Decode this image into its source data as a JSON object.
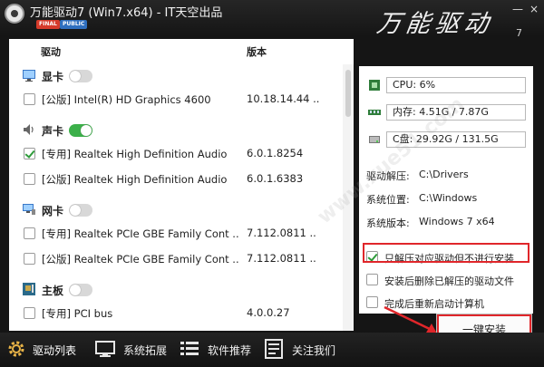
{
  "window": {
    "title": "万能驱动7 (Win7.x64) - IT天空出品",
    "badge_final": "FINAL",
    "badge_public": "PUBLIC",
    "brand": "万能驱动",
    "brand_version": "7",
    "minimize": "—",
    "close": "×"
  },
  "list": {
    "col_driver": "驱动",
    "col_version": "版本",
    "categories": [
      {
        "label": "显卡",
        "toggle_on": false,
        "icon": "display-card-icon",
        "drivers": [
          {
            "name": "[公版] Intel(R) HD Graphics 4600",
            "version": "10.18.14.44 ..",
            "checked": false
          }
        ]
      },
      {
        "label": "声卡",
        "toggle_on": true,
        "icon": "speaker-icon",
        "drivers": [
          {
            "name": "[专用] Realtek High Definition Audio",
            "version": "6.0.1.8254",
            "checked": true
          },
          {
            "name": "[公版] Realtek High Definition Audio",
            "version": "6.0.1.6383",
            "checked": false
          }
        ]
      },
      {
        "label": "网卡",
        "toggle_on": false,
        "icon": "network-icon",
        "drivers": [
          {
            "name": "[专用] Realtek PCIe GBE Family Cont ..",
            "version": "7.112.0811 ..",
            "checked": false
          },
          {
            "name": "[公版] Realtek PCIe GBE Family Cont ..",
            "version": "7.112.0811 ..",
            "checked": false
          }
        ]
      },
      {
        "label": "主板",
        "toggle_on": false,
        "icon": "motherboard-icon",
        "drivers": [
          {
            "name": "[专用] PCI bus",
            "version": "4.0.0.27",
            "checked": false
          }
        ]
      }
    ]
  },
  "system": {
    "cpu": "CPU:  6%",
    "memory": "内存:  4.51G / 7.87G",
    "disk": "C盘:  29.92G / 131.5G",
    "info": [
      {
        "label": "驱动解压:",
        "value": "C:\\Drivers"
      },
      {
        "label": "系统位置:",
        "value": "C:\\Windows"
      },
      {
        "label": "系统版本:",
        "value": "Windows 7 x64"
      }
    ],
    "options": [
      {
        "label": "只解压对应驱动但不进行安装",
        "checked": true
      },
      {
        "label": "安装后删除已解压的驱动文件",
        "checked": false
      },
      {
        "label": "完成后重新启动计算机",
        "checked": false
      }
    ],
    "install_label": "一键安装"
  },
  "nav": [
    {
      "label": "驱动列表",
      "icon": "gear-icon"
    },
    {
      "label": "系统拓展",
      "icon": "monitor-icon"
    },
    {
      "label": "软件推荐",
      "icon": "list-icon"
    },
    {
      "label": "关注我们",
      "icon": "document-icon"
    }
  ],
  "watermark": "www.xue51.com",
  "colors": {
    "highlight": "#e0262a",
    "toggle_on": "#3cb04a",
    "badge_final": "#d63a2a",
    "badge_public": "#2f6fbf"
  }
}
